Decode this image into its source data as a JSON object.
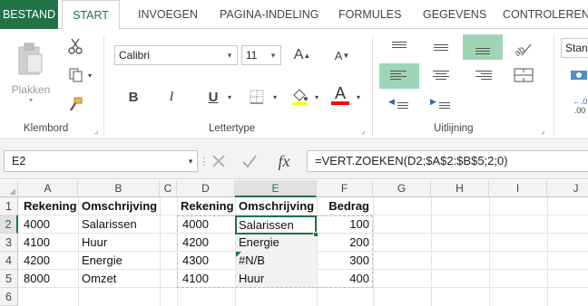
{
  "tabs": [
    "BESTAND",
    "START",
    "INVOEGEN",
    "PAGINA-INDELING",
    "FORMULES",
    "GEGEVENS",
    "CONTROLEREN"
  ],
  "ribbon": {
    "clipboard": {
      "label": "Klembord",
      "paste": "Plakken"
    },
    "font": {
      "label": "Lettertype",
      "name": "Calibri",
      "size": "11",
      "bold": "B",
      "italic": "I",
      "underline": "U",
      "increase": "A",
      "decrease": "A",
      "font_color": "A",
      "font_color_hex": "#ff0000"
    },
    "alignment": {
      "label": "Uitlijning"
    },
    "number": {
      "format": "Stand"
    }
  },
  "formula_bar": {
    "name_box": "E2",
    "fx": "fx",
    "formula": "=VERT.ZOEKEN(D2;$A$2:$B$5;2;0)"
  },
  "columns": [
    "A",
    "B",
    "C",
    "D",
    "E",
    "F",
    "G",
    "H",
    "I",
    "J"
  ],
  "rows": [
    "1",
    "2",
    "3",
    "4",
    "5",
    "6"
  ],
  "table1": {
    "headers": [
      "Rekening",
      "Omschrijving"
    ],
    "rows": [
      [
        "4000",
        "Salarissen"
      ],
      [
        "4100",
        "Huur"
      ],
      [
        "4200",
        "Energie"
      ],
      [
        "8000",
        "Omzet"
      ]
    ]
  },
  "table2": {
    "headers": [
      "Rekening",
      "Omschrijving",
      "Bedrag"
    ],
    "rows": [
      [
        "4000",
        "Salarissen",
        "100"
      ],
      [
        "4200",
        "Energie",
        "200"
      ],
      [
        "4300",
        "#N/B",
        "300"
      ],
      [
        "4100",
        "Huur",
        "400"
      ]
    ]
  },
  "accent": "#217346"
}
